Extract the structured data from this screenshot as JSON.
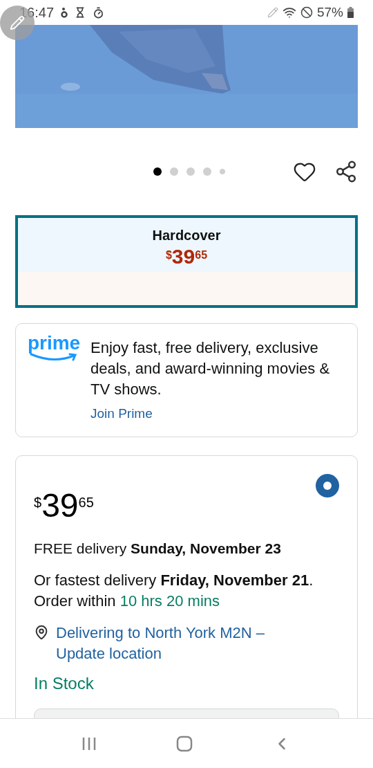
{
  "status_bar": {
    "time": "16:47",
    "battery": "57%"
  },
  "gallery": {
    "dots": [
      {
        "selected": true
      },
      {
        "selected": false
      },
      {
        "selected": false
      },
      {
        "selected": false
      },
      {
        "selected": false
      }
    ]
  },
  "format": {
    "label": "Hardcover",
    "price": {
      "currency": "$",
      "whole": "39",
      "fraction": "65"
    },
    "selected": true
  },
  "prime": {
    "logo": "prime",
    "text": "Enjoy fast, free delivery, exclusive deals, and award-winning movies & TV shows.",
    "link": "Join Prime"
  },
  "offer": {
    "selected": true,
    "price": {
      "currency": "$",
      "whole": "39",
      "fraction": "65"
    },
    "delivery": "FREE delivery **Sunday, November 23**",
    "fastest": "Or fastest delivery **Friday, November 21**. Order within",
    "countdown": "10 hrs 20 mins",
    "location": "Delivering to North York M2N – Update location",
    "stock": "In Stock"
  }
}
